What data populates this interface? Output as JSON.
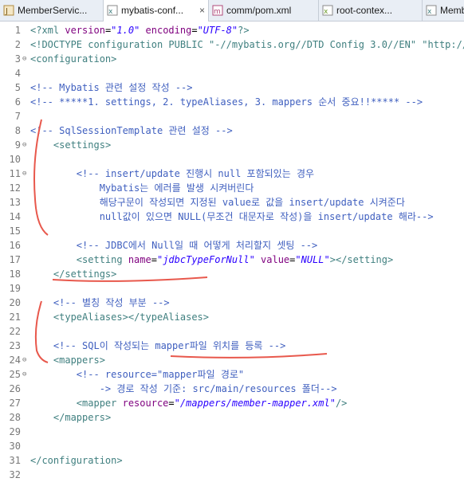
{
  "tabs": [
    {
      "label": "MemberServic...",
      "icon": "java-file-icon",
      "active": false,
      "closable": false
    },
    {
      "label": "mybatis-conf...",
      "icon": "xml-file-icon",
      "active": true,
      "closable": true
    },
    {
      "label": "comm/pom.xml",
      "icon": "maven-pom-icon",
      "active": false,
      "closable": false
    },
    {
      "label": "root-contex...",
      "icon": "spring-xml-icon",
      "active": false,
      "closable": false
    },
    {
      "label": "Memb",
      "icon": "mapper-xml-icon",
      "active": false,
      "closable": false
    }
  ],
  "editor": {
    "lines": [
      {
        "n": "1",
        "fold": "",
        "text": "<?xml version=\"1.0\" encoding=\"UTF-8\"?>"
      },
      {
        "n": "2",
        "fold": "",
        "text": "<!DOCTYPE configuration PUBLIC \"-//mybatis.org//DTD Config 3.0//EN\" \"http://my"
      },
      {
        "n": "3",
        "fold": "⊖",
        "text": "<configuration>"
      },
      {
        "n": "4",
        "fold": "",
        "text": ""
      },
      {
        "n": "5",
        "fold": "",
        "text": "<!-- Mybatis 관련 설정 작성 -->"
      },
      {
        "n": "6",
        "fold": "",
        "text": "<!-- *****1. settings, 2. typeAliases, 3. mappers 순서 중요!!***** -->"
      },
      {
        "n": "7",
        "fold": "",
        "text": ""
      },
      {
        "n": "8",
        "fold": "",
        "text": "<!-- SqlSessionTemplate 관련 설정 -->"
      },
      {
        "n": "9",
        "fold": "⊖",
        "text": "    <settings>"
      },
      {
        "n": "10",
        "fold": "",
        "text": ""
      },
      {
        "n": "11",
        "fold": "⊖",
        "text": "        <!-- insert/update 진행시 null 포함되있는 경우"
      },
      {
        "n": "12",
        "fold": "",
        "text": "            Mybatis는 에러를 발생 시켜버린다"
      },
      {
        "n": "13",
        "fold": "",
        "text": "            해당구문이 작성되면 지정된 value로 값을 insert/update 시켜준다"
      },
      {
        "n": "14",
        "fold": "",
        "text": "            null값이 있으면 NULL(무조건 대문자로 작성)을 insert/update 해라-->"
      },
      {
        "n": "15",
        "fold": "",
        "text": ""
      },
      {
        "n": "16",
        "fold": "",
        "text": "        <!-- JDBC에서 Null일 때 어떻게 처리할지 셋팅 -->"
      },
      {
        "n": "17",
        "fold": "",
        "text": "        <setting name=\"jdbcTypeForNull\" value=\"NULL\"></setting>"
      },
      {
        "n": "18",
        "fold": "",
        "text": "    </settings>"
      },
      {
        "n": "19",
        "fold": "",
        "text": ""
      },
      {
        "n": "20",
        "fold": "",
        "text": "    <!-- 별칭 작성 부분 -->"
      },
      {
        "n": "21",
        "fold": "",
        "text": "    <typeAliases></typeAliases>"
      },
      {
        "n": "22",
        "fold": "",
        "text": ""
      },
      {
        "n": "23",
        "fold": "",
        "text": "    <!-- SQL이 작성되는 mapper파일 위치를 등록 -->"
      },
      {
        "n": "24",
        "fold": "⊖",
        "text": "    <mappers>"
      },
      {
        "n": "25",
        "fold": "⊖",
        "text": "        <!-- resource=\"mapper파일 경로\""
      },
      {
        "n": "26",
        "fold": "",
        "text": "            -> 경로 작성 기준: src/main/resources 폴더-->"
      },
      {
        "n": "27",
        "fold": "",
        "text": "        <mapper resource=\"/mappers/member-mapper.xml\"/>"
      },
      {
        "n": "28",
        "fold": "",
        "text": "    </mappers>"
      },
      {
        "n": "29",
        "fold": "",
        "text": ""
      },
      {
        "n": "30",
        "fold": "",
        "text": ""
      },
      {
        "n": "31",
        "fold": "",
        "text": "</configuration>"
      },
      {
        "n": "32",
        "fold": "",
        "text": ""
      }
    ]
  },
  "colors": {
    "comment": "#3f5fbf",
    "tag": "#3f7f7f",
    "attribute": "#7f007f",
    "string": "#2a00ff",
    "annotation_marks": "#e8584c"
  }
}
